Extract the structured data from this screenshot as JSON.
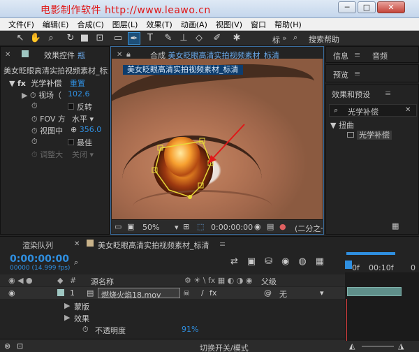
{
  "window": {
    "title": "电影制作软件  http://www.leawo.cn",
    "controls": [
      "─",
      "□",
      "✕"
    ]
  },
  "menu": [
    "文件(F)",
    "编辑(E)",
    "合成(C)",
    "图层(L)",
    "效果(T)",
    "动画(A)",
    "视图(V)",
    "窗口",
    "帮助(H)"
  ],
  "toolbar": {
    "workspace_label": "标",
    "search_label": "搜索帮助"
  },
  "effects_panel": {
    "tab_label": "效果控件",
    "tab_target": "瓶",
    "layer_path": "美女眨眼高清实拍视频素材_标清",
    "effect_name": "光学补偿",
    "reset_label": "重置",
    "properties": [
      {
        "name": "视场（",
        "value": "102.6"
      },
      {
        "name": "",
        "value": "反转"
      },
      {
        "name": "FOV 方",
        "value": "水平"
      },
      {
        "name": "视图中",
        "value": "356.0"
      },
      {
        "name": "",
        "value": "最佳"
      },
      {
        "name": "调整大",
        "value": "关闭"
      }
    ]
  },
  "comp_panel": {
    "tab_label": "合成",
    "comp_name": "美女眨眼高清实拍视频素材_标清",
    "subtab": "美女眨眼高清实拍视频素材_标清",
    "zoom": "50%",
    "timecode": "0:00:00:00",
    "resolution": "(二分之一"
  },
  "info_panel": {
    "tabs": [
      "信息",
      "音频"
    ],
    "preview_tab": "预览"
  },
  "effects_presets": {
    "tab_label": "效果和预设",
    "search_value": "光学补偿",
    "category": "扭曲",
    "item": "光学补偿"
  },
  "timeline": {
    "render_queue_tab": "渲染队列",
    "comp_tab": "美女眨眼高清实拍视频素材_标清",
    "timecode": "0:00:00:00",
    "frame_info": "00000 (14.999 fps)",
    "columns": {
      "source_name": "源名称",
      "parent": "父级"
    },
    "layer": {
      "index": "1",
      "name": "燃烧火焰18.mov",
      "parent_value": "无"
    },
    "sublayers": [
      "蒙版",
      "效果"
    ],
    "opacity": {
      "label": "不透明度",
      "value": "91%"
    },
    "ruler": [
      "0f",
      "00:10f",
      "0"
    ],
    "footer": "切换开关/模式"
  }
}
